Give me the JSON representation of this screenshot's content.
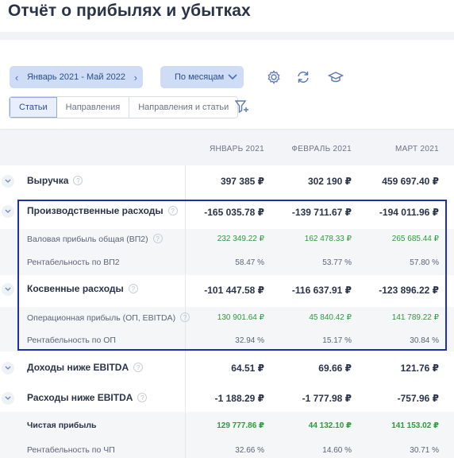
{
  "page": {
    "title": "Отчёт о прибылях и убытках"
  },
  "toolbar": {
    "period_label": "Январь 2021 - Май 2022",
    "prev_icon": "chevron-left-icon",
    "next_icon": "chevron-right-icon",
    "grouping_label": "По месяцам",
    "tabs": [
      "Статьи",
      "Направления",
      "Направления и статьи"
    ],
    "active_tab": "Статьи"
  },
  "table": {
    "columns": [
      "ЯНВАРЬ 2021",
      "ФЕВРАЛЬ 2021",
      "МАРТ 2021"
    ],
    "rows": [
      {
        "label": "Выручка",
        "v": [
          "397 385 ₽",
          "302 190 ₽",
          "459 697.40 ₽"
        ]
      },
      {
        "label": "Производственные расходы",
        "v": [
          "-165 035.78 ₽",
          "-139 711.67 ₽",
          "-194 011.96 ₽"
        ]
      },
      {
        "label": "Валовая прибыль общая (ВП2)",
        "v": [
          "232 349.22 ₽",
          "162 478.33 ₽",
          "265 685.44 ₽"
        ]
      },
      {
        "label": "Рентабельность по ВП2",
        "v": [
          "58.47 %",
          "53.77 %",
          "57.80 %"
        ]
      },
      {
        "label": "Косвенные расходы",
        "v": [
          "-101 447.58 ₽",
          "-116 637.91 ₽",
          "-123 896.22 ₽"
        ]
      },
      {
        "label": "Операционная прибыль (ОП, EBITDA)",
        "v": [
          "130 901.64 ₽",
          "45 840.42 ₽",
          "141 789.22 ₽"
        ]
      },
      {
        "label": "Рентабельность по ОП",
        "v": [
          "32.94 %",
          "15.17 %",
          "30.84 %"
        ]
      },
      {
        "label": "Доходы ниже EBITDA",
        "v": [
          "64.51 ₽",
          "69.66 ₽",
          "121.76 ₽"
        ]
      },
      {
        "label": "Расходы ниже EBITDA",
        "v": [
          "-1 188.29 ₽",
          "-1 777.98 ₽",
          "-757.96 ₽"
        ]
      },
      {
        "label": "Чистая прибыль",
        "v": [
          "129 777.86 ₽",
          "44 132.10 ₽",
          "141 153.02 ₽"
        ]
      },
      {
        "label": "Рентабельность по ЧП",
        "v": [
          "32.66 %",
          "14.60 %",
          "30.71 %"
        ]
      }
    ]
  },
  "colors": {
    "accent": "#cfdcf6",
    "positive": "#2a9a3d",
    "highlight_border": "#1f2fb0"
  }
}
